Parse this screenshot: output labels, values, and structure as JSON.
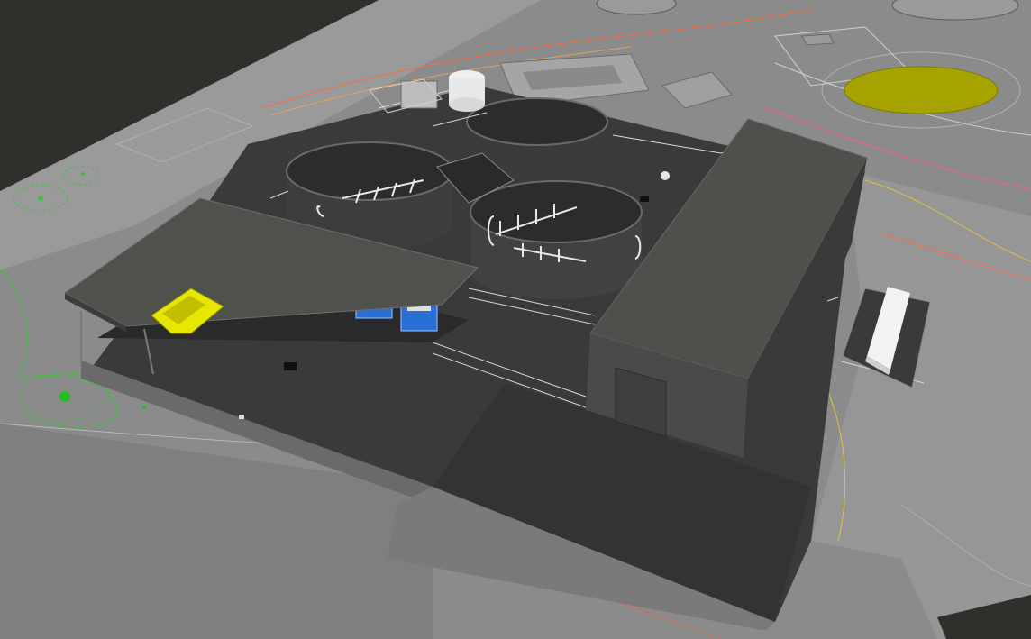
{
  "viewport": {
    "background_color": "#2f2f2b",
    "terrain_color": "#8a8a8a",
    "pad_color": "#3a3a3a",
    "roof_color": "#4e504c",
    "tank_color": "#3b3b3b",
    "tank_rim_color": "#5c5c5c",
    "equipment_color": "#2a6fd6",
    "vehicle_color": "#e6e600",
    "pond_color": "#a6a300",
    "grid_line_color": "#ff8040",
    "survey_line_colors": [
      "#ff6a3a",
      "#e0c040",
      "#40c040",
      "#ff5a9a",
      "#ffffff"
    ]
  }
}
